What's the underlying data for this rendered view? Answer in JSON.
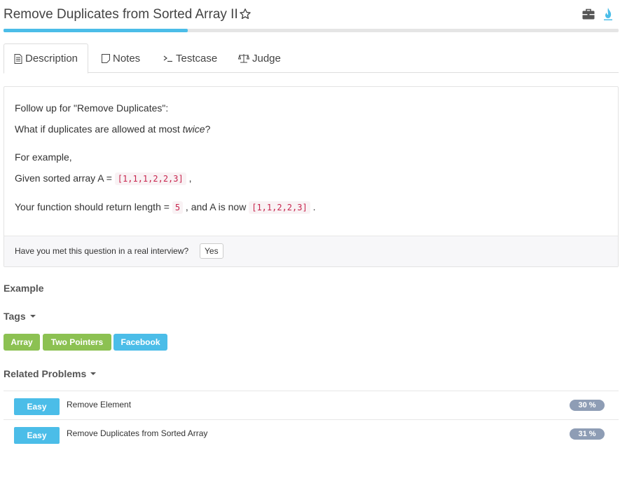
{
  "header": {
    "title": "Remove Duplicates from Sorted Array II",
    "progress_fraction": 0.3
  },
  "tabs": [
    {
      "label": "Description",
      "icon": "document-icon"
    },
    {
      "label": "Notes",
      "icon": "note-icon"
    },
    {
      "label": "Testcase",
      "icon": "terminal-icon"
    },
    {
      "label": "Judge",
      "icon": "scale-icon"
    }
  ],
  "description": {
    "line1": "Follow up for \"Remove Duplicates\":",
    "line2_before": "What if duplicates are allowed at most ",
    "line2_em": "twice",
    "line2_after": "?",
    "line3": "For example,",
    "line4_before": "Given sorted array A = ",
    "line4_code": "[1,1,1,2,2,3]",
    "line4_after": " ,",
    "line5_before": "Your function should return length = ",
    "line5_code1": "5",
    "line5_mid": " , and A is now ",
    "line5_code2": "[1,1,2,2,3]",
    "line5_after": " ."
  },
  "interview": {
    "question": "Have you met this question in a real interview?",
    "yes_label": "Yes"
  },
  "example_heading": "Example",
  "tags_heading": "Tags",
  "tags": [
    {
      "label": "Array",
      "color": "#8cc152"
    },
    {
      "label": "Two Pointers",
      "color": "#8cc152"
    },
    {
      "label": "Facebook",
      "color": "#4bbde8"
    }
  ],
  "related_heading": "Related Problems",
  "related": [
    {
      "difficulty": "Easy",
      "name": "Remove Element",
      "rate": "30 %"
    },
    {
      "difficulty": "Easy",
      "name": "Remove Duplicates from Sorted Array",
      "rate": "31 %"
    }
  ]
}
